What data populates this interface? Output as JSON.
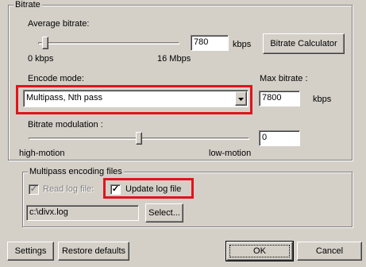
{
  "bitrate_group": {
    "title": "Bitrate",
    "average_label": "Average bitrate:",
    "average_value": "780",
    "average_unit": "kbps",
    "calculator_button": "Bitrate Calculator",
    "min_label": "0 kbps",
    "max_label": "16 Mbps",
    "average_slider_fraction": 0.05,
    "encode_mode_label": "Encode mode:",
    "encode_mode_value": "Multipass, Nth pass",
    "max_bitrate_label": "Max bitrate :",
    "max_bitrate_value": "7800",
    "max_bitrate_unit": "kbps",
    "modulation_label": "Bitrate modulation :",
    "modulation_value": "0",
    "modulation_left": "high-motion",
    "modulation_right": "low-motion",
    "modulation_slider_fraction": 0.5
  },
  "multipass_group": {
    "title": "Multipass encoding files",
    "read_log_label": "Read log file:",
    "read_log_checked": true,
    "update_log_label": "Update log file",
    "update_log_checked": true,
    "log_path": "c:\\divx.log",
    "select_button": "Select..."
  },
  "footer": {
    "settings_button": "Settings",
    "restore_button": "Restore defaults",
    "ok_button": "OK",
    "cancel_button": "Cancel"
  },
  "colors": {
    "highlight": "#e0141e",
    "face": "#d4d0c8"
  },
  "icons": {
    "check": "check-mark-icon",
    "dropdown": "dropdown-arrow-icon"
  }
}
